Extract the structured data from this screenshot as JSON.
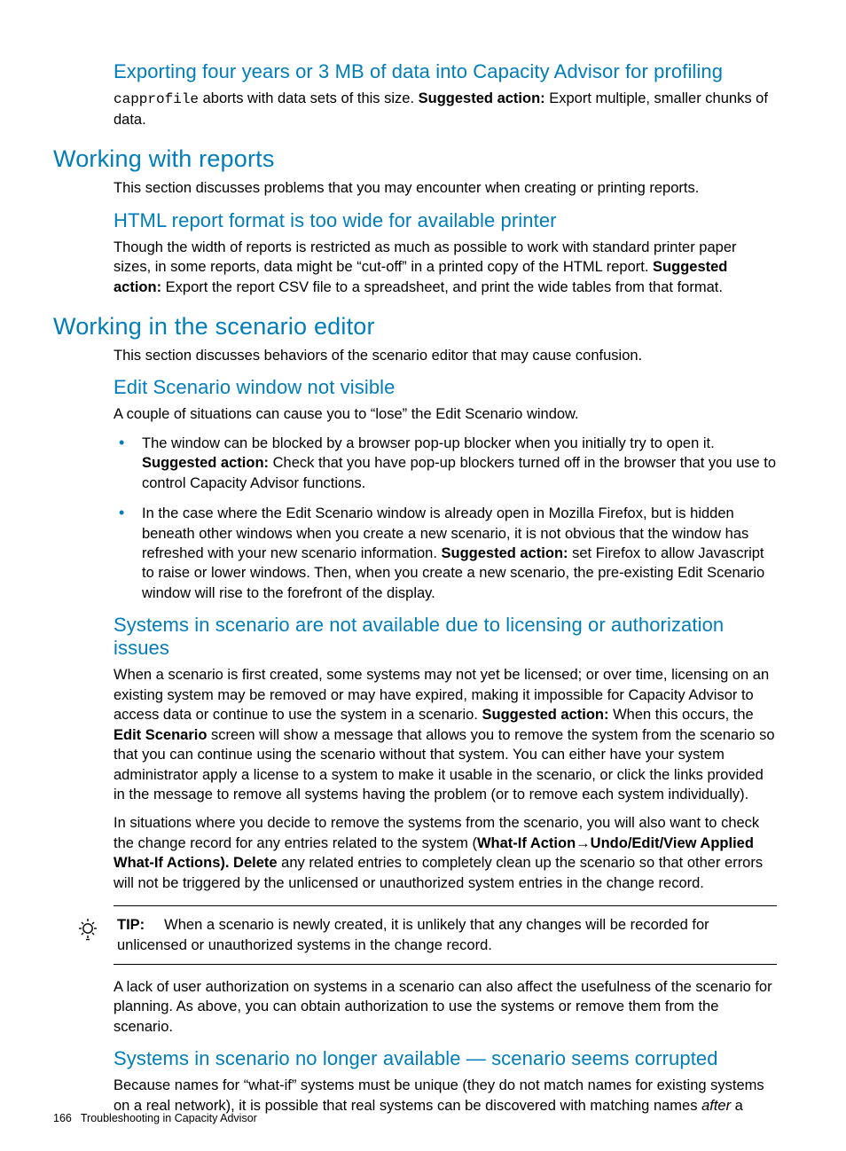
{
  "s1": {
    "heading": "Exporting four years or 3 MB of data into Capacity Advisor for profiling",
    "para_code": "capprofile",
    "para_pre": " aborts with data sets of this size. ",
    "para_bold": "Suggested action:",
    "para_post": " Export multiple, smaller chunks of data."
  },
  "s2": {
    "heading": "Working with reports",
    "intro": "This section discusses problems that you may encounter when creating or printing reports.",
    "sub1": {
      "heading": "HTML report format is too wide for available printer",
      "para_pre": "Though the width of reports is restricted as much as possible to work with standard printer paper sizes, in some reports, data might be “cut-off” in a printed copy of the HTML report. ",
      "para_bold": "Suggested action:",
      "para_post": " Export the report CSV file to a spreadsheet, and print the wide tables from that format."
    }
  },
  "s3": {
    "heading": "Working in the scenario editor",
    "intro": "This section discusses behaviors of the scenario editor that may cause confusion.",
    "sub1": {
      "heading": "Edit Scenario window not visible",
      "para": "A couple of situations can cause you to “lose” the Edit Scenario window.",
      "b1_pre": "The window can be blocked by a browser pop-up blocker when you initially try to open it. ",
      "b1_bold": "Suggested action:",
      "b1_post": " Check that you have pop-up blockers turned off in the browser that you use to control Capacity Advisor functions.",
      "b2_pre": "In the case where the Edit Scenario window is already open in Mozilla Firefox, but is hidden beneath other windows when you create a new scenario, it is not obvious that the window has refreshed with your new scenario information. ",
      "b2_bold": "Suggested action:",
      "b2_post": " set Firefox to allow Javascript to raise or lower windows. Then, when you create a new scenario, the pre-existing Edit Scenario window will rise to the forefront of the display."
    },
    "sub2": {
      "heading": "Systems in scenario are not available due to licensing or authorization issues",
      "p1_pre": "When a scenario is first created, some systems may not yet be licensed; or over time, licensing on an existing system may be removed or may have expired, making it impossible for Capacity Advisor to access data or continue to use the system in a scenario. ",
      "p1_bold1": "Suggested action:",
      "p1_mid": " When this occurs, the ",
      "p1_bold2": "Edit Scenario",
      "p1_post": " screen will show a message that allows you to remove the system from the scenario so that you can continue using the scenario without that system. You can either have your system administrator apply a license to a system to make it usable in the scenario, or click the links provided in the message to remove all systems having the problem (or to remove each system individually).",
      "p2_pre": "In situations where you decide to remove the systems from the scenario, you will also want to check the change record for any entries related to the system (",
      "p2_bold1": "What-If Action",
      "p2_arrow": "→",
      "p2_bold2": "Undo/Edit/View Applied What-If Actions). Delete",
      "p2_post": " any related entries to completely clean up the scenario so that other errors will not be triggered by the unlicensed or unauthorized system entries in the change record.",
      "tip_label": "TIP:",
      "tip_text": "When a scenario is newly created, it is unlikely that any changes will be recorded for unlicensed or unauthorized systems in the change record.",
      "p3": "A lack of user authorization on systems in a scenario can also affect the usefulness of the scenario for planning. As above, you can obtain authorization to use the systems or remove them from the scenario."
    },
    "sub3": {
      "heading": "Systems in scenario no longer available — scenario seems corrupted",
      "p_pre": "Because names for “what-if” systems must be unique (they do not match names for existing systems on a real network), it is possible that real systems can be discovered with matching names ",
      "p_italic": "after",
      "p_post": " a"
    }
  },
  "footer": {
    "page": "166",
    "title": "Troubleshooting in Capacity Advisor"
  }
}
